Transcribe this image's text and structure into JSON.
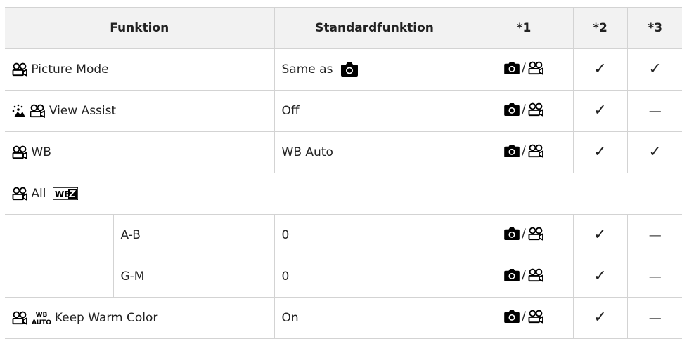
{
  "table": {
    "headers": [
      "Funktion",
      "Standardfunktion",
      "*1",
      "*2",
      "*3"
    ],
    "rows": {
      "picture_mode": {
        "label": "Picture Mode",
        "default_prefix": "Same as",
        "col2": "✓",
        "col3": "✓"
      },
      "view_assist": {
        "label": "View Assist",
        "default": "Off",
        "col2": "✓",
        "col3": "—"
      },
      "wb": {
        "label": "WB",
        "default": "WB Auto",
        "col2": "✓",
        "col3": "✓"
      },
      "all_wbz": {
        "label": "All"
      },
      "a_b": {
        "label": "A-B",
        "default": "0",
        "col2": "✓",
        "col3": "—"
      },
      "g_m": {
        "label": "G-M",
        "default": "0",
        "col2": "✓",
        "col3": "—"
      },
      "keep_warm": {
        "label": "Keep Warm Color",
        "default": "On",
        "col2": "✓",
        "col3": "—"
      }
    },
    "mode_slash": "/",
    "wb_icon_text": "WB",
    "wb_auto_icon_text": {
      "top": "WB",
      "bottom": "AUTO"
    }
  }
}
